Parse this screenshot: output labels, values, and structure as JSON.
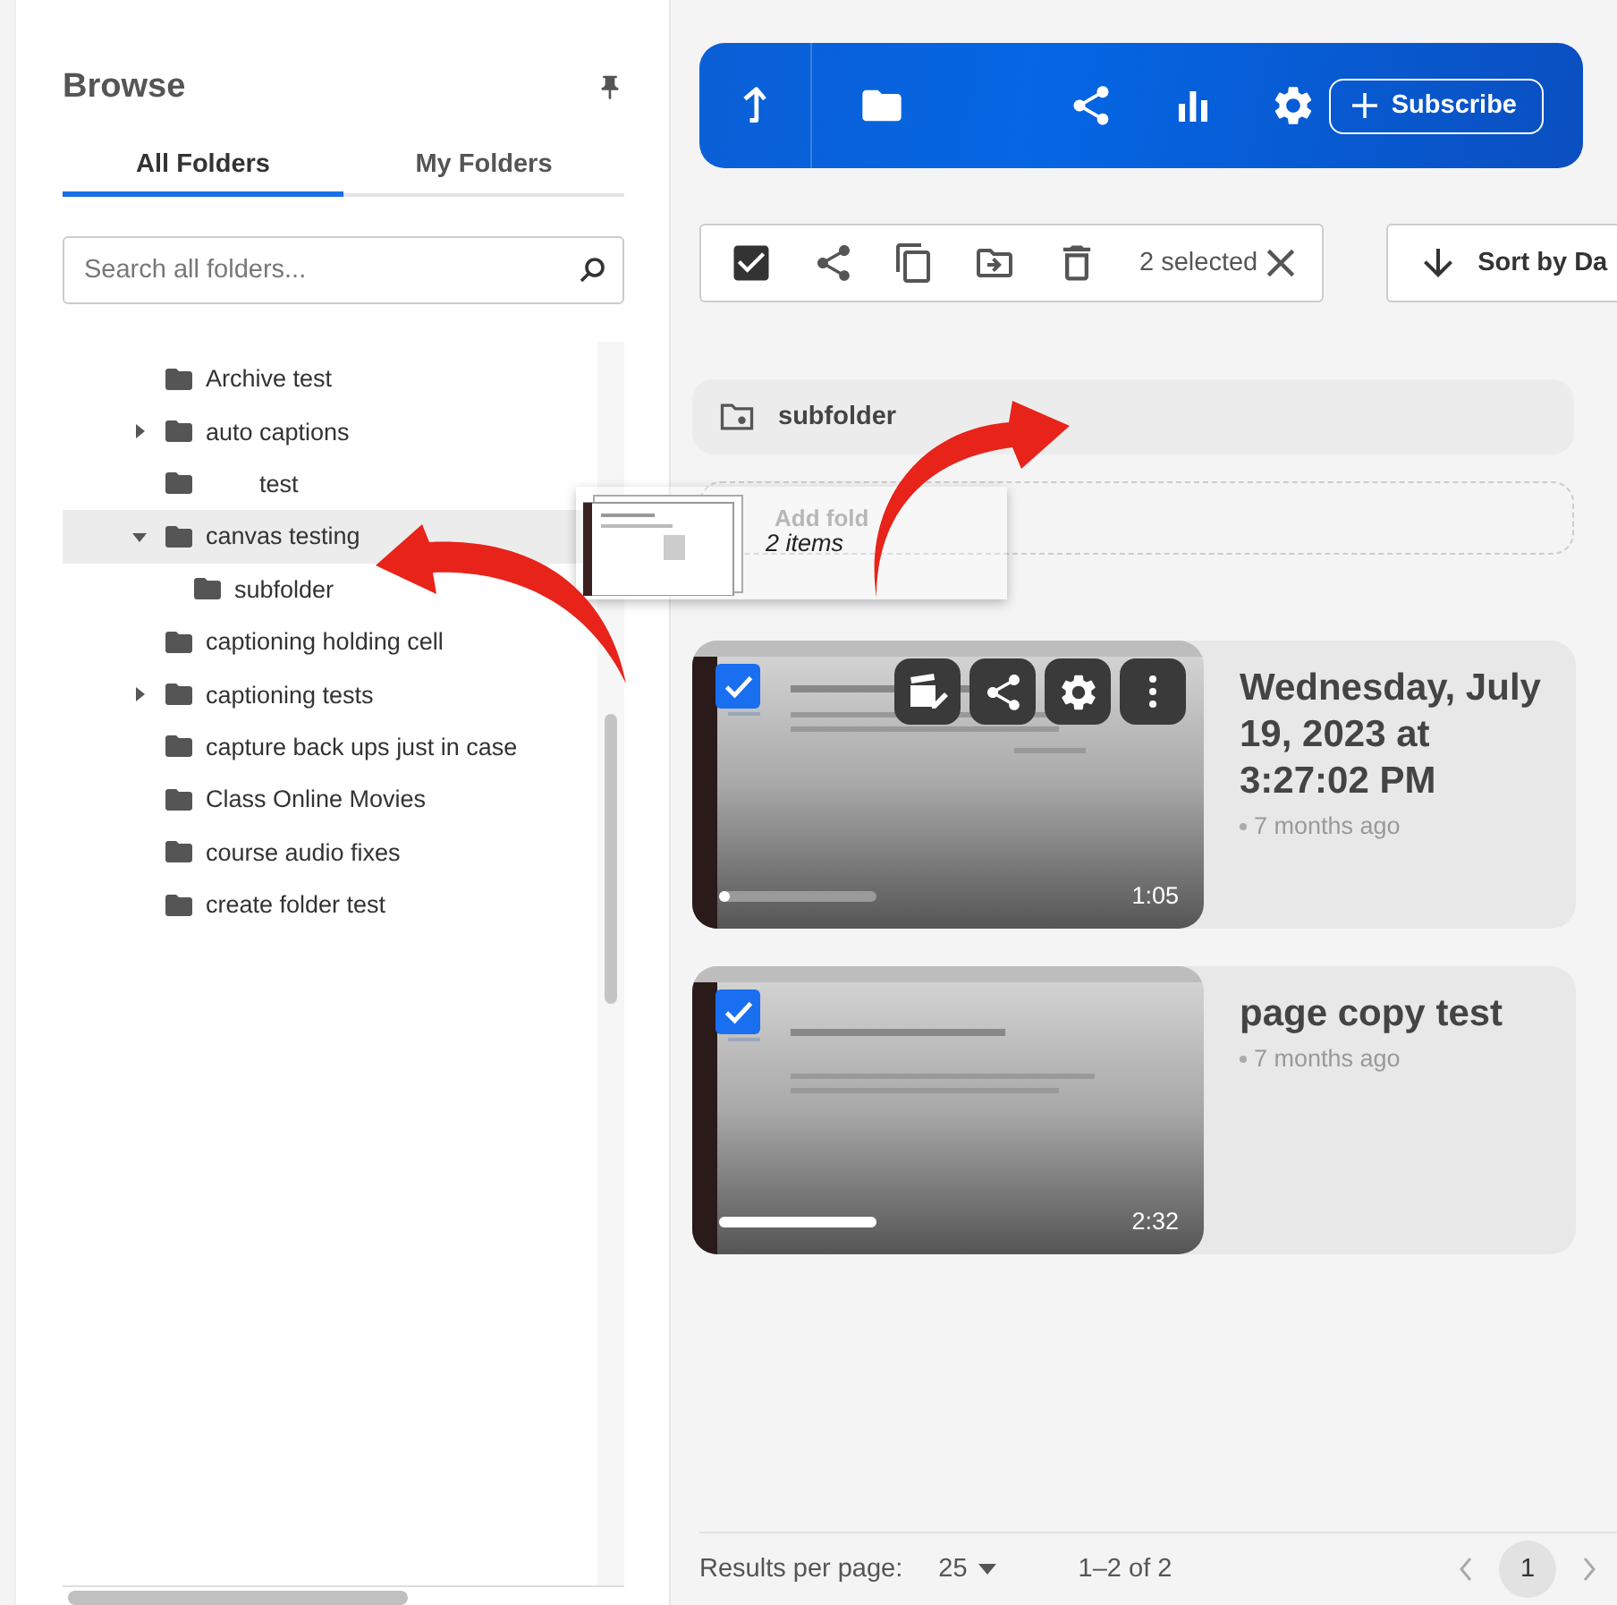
{
  "sidebar": {
    "title": "Browse",
    "tabs": [
      {
        "label": "All Folders",
        "selected": true
      },
      {
        "label": "My Folders",
        "selected": false
      }
    ],
    "search": {
      "placeholder": "Search all folders..."
    },
    "tree": [
      {
        "label": "Archive test",
        "kind": "leaf",
        "selected": false
      },
      {
        "label": "auto captions",
        "kind": "branch",
        "expanded": false,
        "selected": false
      },
      {
        "label": "        test",
        "kind": "leaf",
        "selected": false
      },
      {
        "label": "canvas testing",
        "kind": "branch",
        "expanded": true,
        "selected": true,
        "children": [
          {
            "label": "subfolder",
            "kind": "leaf",
            "selected": false
          }
        ]
      },
      {
        "label": "captioning holding cell",
        "kind": "leaf",
        "selected": false
      },
      {
        "label": "captioning tests",
        "kind": "branch",
        "expanded": false,
        "selected": false
      },
      {
        "label": "capture back ups just in case",
        "kind": "leaf",
        "selected": false
      },
      {
        "label": "Class Online Movies",
        "kind": "leaf",
        "selected": false
      },
      {
        "label": "course audio fixes",
        "kind": "leaf",
        "selected": false
      },
      {
        "label": "create folder test",
        "kind": "leaf",
        "selected": false
      }
    ]
  },
  "header": {
    "subscribe": "Subscribe"
  },
  "selection_bar": {
    "checked": true,
    "count": "2 selected",
    "sort": "Sort by Da"
  },
  "folders": [
    {
      "name": "subfolder"
    }
  ],
  "add_folder": {
    "label": "Add fold"
  },
  "drag_ghost": {
    "label": "2 items"
  },
  "videos": [
    {
      "title": "Wednesday, July 19, 2023 at 3:27:02 PM",
      "age": "7 months ago",
      "duration": "1:05",
      "checked": true,
      "actions": true,
      "level": 0.05
    },
    {
      "title": "page copy test",
      "age": "7 months ago",
      "duration": "2:32",
      "checked": true,
      "actions": false,
      "level": 1
    }
  ],
  "footer": {
    "per_page_label": "Results per page:",
    "per_page": "25",
    "range": "1–2 of 2",
    "pages": [
      {
        "label": "1",
        "selected": true
      }
    ]
  }
}
